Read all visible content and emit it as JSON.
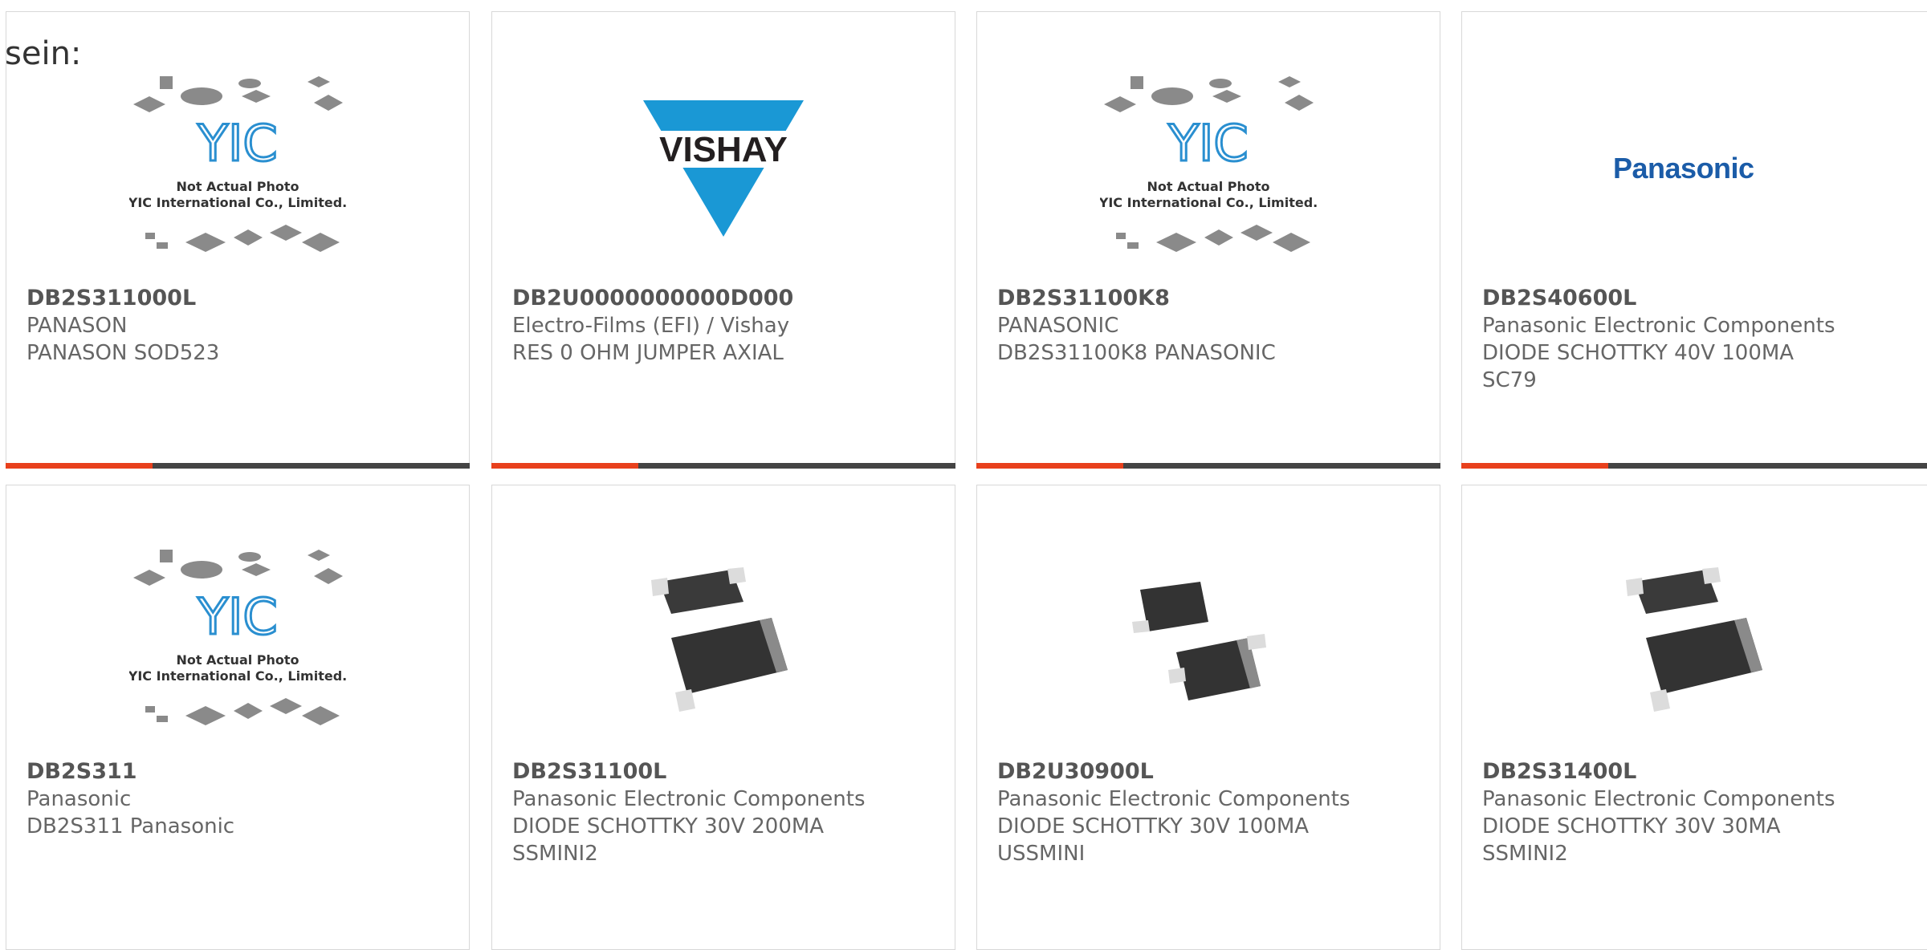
{
  "intro_text": "sein:",
  "products": [
    {
      "part": "DB2S311000L",
      "manufacturer": "PANASON",
      "description": "PANASON SOD523",
      "image": "yic-placeholder-image",
      "accent": "#e8401c"
    },
    {
      "part": "DB2U0000000000D000",
      "manufacturer": "Electro-Films (EFI) / Vishay",
      "description": "RES 0 OHM JUMPER AXIAL",
      "image": "vishay-logo",
      "accent": "#e8401c"
    },
    {
      "part": "DB2S31100K8",
      "manufacturer": "PANASONIC",
      "description": "DB2S31100K8 PANASONIC",
      "image": "yic-placeholder-image",
      "accent": "#e8401c"
    },
    {
      "part": "DB2S40600L",
      "manufacturer": "Panasonic Electronic Components",
      "description": "DIODE SCHOTTKY 40V 100MA SC79",
      "image": "panasonic-logo",
      "accent": "#e8401c"
    },
    {
      "part": "DB2S311",
      "manufacturer": "Panasonic",
      "description": "DB2S311 Panasonic",
      "image": "yic-placeholder-image"
    },
    {
      "part": "DB2S31100L",
      "manufacturer": "Panasonic Electronic Components",
      "description": "DIODE SCHOTTKY 30V 200MA SSMINI2",
      "image": "diode-package-image"
    },
    {
      "part": "DB2U30900L",
      "manufacturer": "Panasonic Electronic Components",
      "description": "DIODE SCHOTTKY 30V 100MA USSMINI",
      "image": "diode-package-image"
    },
    {
      "part": "DB2S31400L",
      "manufacturer": "Panasonic Electronic Components",
      "description": "DIODE SCHOTTKY 30V 30MA SSMINI2",
      "image": "diode-package-image"
    }
  ],
  "placeholder": {
    "line1": "Not Actual Photo",
    "line2": "YIC International Co., Limited.",
    "logo": "YIC"
  },
  "vishay_logo_text": "VISHAY",
  "panasonic_logo_text": "Panasonic",
  "colors": {
    "accent": "#e8401c",
    "bar": "#444444",
    "vishay_blue": "#1a98d5",
    "panasonic_blue": "#1b5ca8",
    "yic_blue": "#2a8fd0"
  }
}
